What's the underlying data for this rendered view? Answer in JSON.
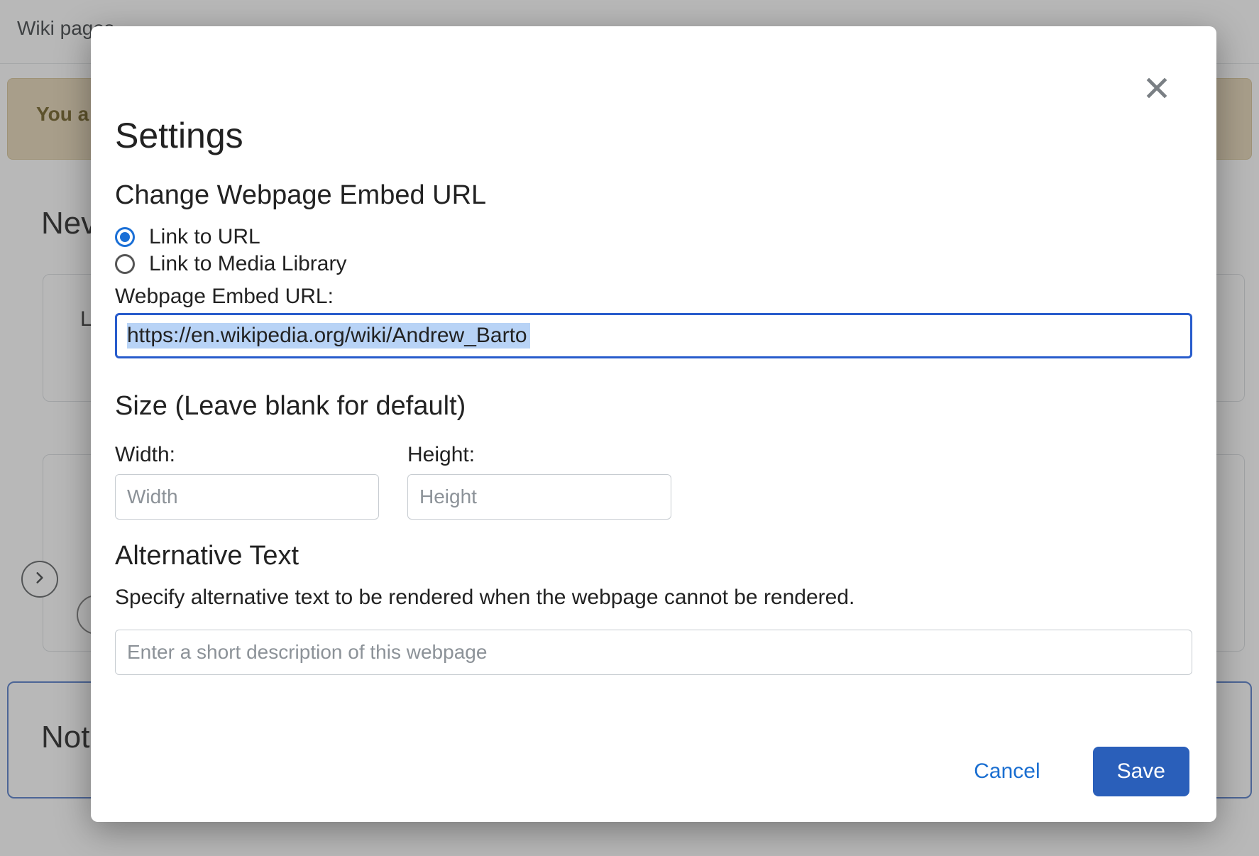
{
  "background": {
    "wiki_pages": "Wiki pages",
    "banner": "You a",
    "subtitle": "Nev",
    "panel1_letter": "L",
    "panel3_label": "Not"
  },
  "modal": {
    "title": "Settings",
    "section_change_url": "Change Webpage Embed URL",
    "radio_link_url": "Link to URL",
    "radio_link_media": "Link to Media Library",
    "embed_url_label": "Webpage Embed URL:",
    "embed_url_value": "https://en.wikipedia.org/wiki/Andrew_Barto",
    "section_size": "Size (Leave blank for default)",
    "width_label": "Width:",
    "width_placeholder": "Width",
    "height_label": "Height:",
    "height_placeholder": "Height",
    "section_alt": "Alternative Text",
    "alt_desc": "Specify alternative text to be rendered when the webpage cannot be rendered.",
    "alt_placeholder": "Enter a short description of this webpage",
    "cancel": "Cancel",
    "save": "Save"
  }
}
